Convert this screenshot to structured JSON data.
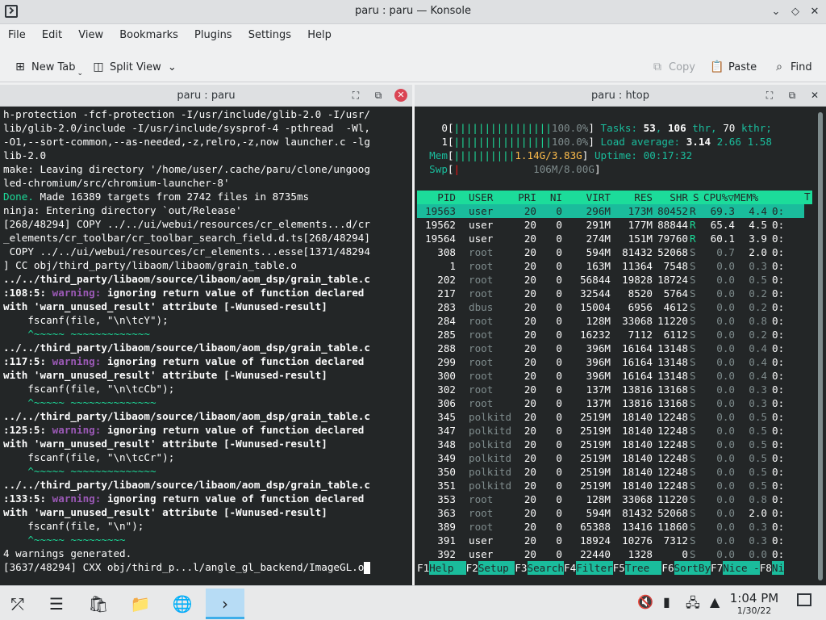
{
  "window": {
    "title": "paru : paru — Konsole"
  },
  "menu": [
    "File",
    "Edit",
    "View",
    "Bookmarks",
    "Plugins",
    "Settings",
    "Help"
  ],
  "toolbar": {
    "new_tab": "New Tab",
    "split_view": "Split View",
    "copy": "Copy",
    "paste": "Paste",
    "find": "Find"
  },
  "left_pane": {
    "title": "paru : paru",
    "lines": [
      {
        "t": "h-protection -fcf-protection -I/usr/include/glib-2.0 -I/usr/",
        "s": ""
      },
      {
        "t": "lib/glib-2.0/include -I/usr/include/sysprof-4 -pthread  -Wl,",
        "s": ""
      },
      {
        "t": "-O1,--sort-common,--as-needed,-z,relro,-z,now launcher.c -lg",
        "s": ""
      },
      {
        "t": "lib-2.0",
        "s": ""
      },
      {
        "t": "make: Leaving directory '/home/user/.cache/paru/clone/ungoog",
        "s": ""
      },
      {
        "t": "led-chromium/src/chromium-launcher-8'",
        "s": ""
      },
      {
        "t": "",
        "s": "done"
      },
      {
        "t": "ninja: Entering directory `out/Release'",
        "s": ""
      },
      {
        "t": "[268/48294] COPY ../../ui/webui/resources/cr_elements...d/cr",
        "s": ""
      },
      {
        "t": "_elements/cr_toolbar/cr_toolbar_search_field.d.ts[268/48294]",
        "s": ""
      },
      {
        "t": " COPY ../../ui/webui/resources/cr_elements...esse[1371/48294",
        "s": ""
      },
      {
        "t": "] CC obj/third_party/libaom/libaom/grain_table.o",
        "s": ""
      },
      {
        "t": "../../third_party/libaom/source/libaom/aom_dsp/grain_table.c",
        "s": "bold"
      },
      {
        "t": ":108:5: ",
        "s": "warn",
        "w": "ignoring return value of function declared"
      },
      {
        "t": "with 'warn_unused_result' attribute [-Wunused-result]",
        "s": "bold"
      },
      {
        "t": "    fscanf(file, \"\\n\\tcY\");",
        "s": ""
      },
      {
        "t": "    ^~~~~~ ~~~~~~~~~~~~~",
        "s": "green"
      },
      {
        "t": "../../third_party/libaom/source/libaom/aom_dsp/grain_table.c",
        "s": "bold"
      },
      {
        "t": ":117:5: ",
        "s": "warn",
        "w": "ignoring return value of function declared"
      },
      {
        "t": "with 'warn_unused_result' attribute [-Wunused-result]",
        "s": "bold"
      },
      {
        "t": "    fscanf(file, \"\\n\\tcCb\");",
        "s": ""
      },
      {
        "t": "    ^~~~~~ ~~~~~~~~~~~~~~",
        "s": "green"
      },
      {
        "t": "../../third_party/libaom/source/libaom/aom_dsp/grain_table.c",
        "s": "bold"
      },
      {
        "t": ":125:5: ",
        "s": "warn",
        "w": "ignoring return value of function declared"
      },
      {
        "t": "with 'warn_unused_result' attribute [-Wunused-result]",
        "s": "bold"
      },
      {
        "t": "    fscanf(file, \"\\n\\tcCr\");",
        "s": ""
      },
      {
        "t": "    ^~~~~~ ~~~~~~~~~~~~~~",
        "s": "green"
      },
      {
        "t": "../../third_party/libaom/source/libaom/aom_dsp/grain_table.c",
        "s": "bold"
      },
      {
        "t": ":133:5: ",
        "s": "warn",
        "w": "ignoring return value of function declared"
      },
      {
        "t": "with 'warn_unused_result' attribute [-Wunused-result]",
        "s": "bold"
      },
      {
        "t": "    fscanf(file, \"\\n\");",
        "s": ""
      },
      {
        "t": "    ^~~~~~ ~~~~~~~~~",
        "s": "green"
      },
      {
        "t": "4 warnings generated.",
        "s": ""
      },
      {
        "t": "[3637/48294] CXX obj/third_p...l/angle_gl_backend/ImageGL.o",
        "s": "cursor"
      }
    ],
    "done_word": "Done.",
    "done_rest": " Made 16389 targets from 2742 files in 8735ms",
    "warning_word": "warning:"
  },
  "right_pane": {
    "title": "paru : htop",
    "cpu0": {
      "label": "0",
      "bar": "||||||||||||||||",
      "pct": "100.0%"
    },
    "cpu1": {
      "label": "1",
      "bar": "||||||||||||||||",
      "pct": "100.0%"
    },
    "mem": {
      "label": "Mem",
      "bar": "||||||||||",
      "val": "1.14G/3.83G"
    },
    "swp": {
      "label": "Swp",
      "bar": "|",
      "val": "106M/8.00G"
    },
    "tasks": {
      "label": "Tasks: ",
      "tasks": "53",
      "thr": "106",
      "kthr": "70",
      "thr_label": " thr, ",
      "kthr_label": " kthr;"
    },
    "load": {
      "label": "Load average: ",
      "v1": "3.14",
      "v2": "2.66",
      "v3": "1.58"
    },
    "uptime": {
      "label": "Uptime: ",
      "value": "00:17:32"
    },
    "header": [
      "PID",
      "USER",
      "PRI",
      "NI",
      "VIRT",
      "RES",
      "SHR",
      "S",
      "CPU%▽MEM%",
      "T"
    ],
    "rows": [
      [
        "19563",
        "user",
        "20",
        "0",
        "296M",
        "173M",
        "80452",
        "R",
        "69.3",
        "4.4",
        "0:"
      ],
      [
        "19562",
        "user",
        "20",
        "0",
        "291M",
        "177M",
        "88844",
        "R",
        "65.4",
        "4.5",
        "0:"
      ],
      [
        "19564",
        "user",
        "20",
        "0",
        "274M",
        "151M",
        "79760",
        "R",
        "60.1",
        "3.9",
        "0:"
      ],
      [
        "308",
        "root",
        "20",
        "0",
        "594M",
        "81432",
        "52068",
        "S",
        "0.7",
        "2.0",
        "0:"
      ],
      [
        "1",
        "root",
        "20",
        "0",
        "163M",
        "11364",
        "7548",
        "S",
        "0.0",
        "0.3",
        "0:"
      ],
      [
        "202",
        "root",
        "20",
        "0",
        "56844",
        "19828",
        "18724",
        "S",
        "0.0",
        "0.5",
        "0:"
      ],
      [
        "217",
        "root",
        "20",
        "0",
        "32544",
        "8520",
        "5764",
        "S",
        "0.0",
        "0.2",
        "0:"
      ],
      [
        "283",
        "dbus",
        "20",
        "0",
        "15004",
        "6956",
        "4612",
        "S",
        "0.0",
        "0.2",
        "0:"
      ],
      [
        "284",
        "root",
        "20",
        "0",
        "128M",
        "33068",
        "11220",
        "S",
        "0.0",
        "0.8",
        "0:"
      ],
      [
        "285",
        "root",
        "20",
        "0",
        "16232",
        "7112",
        "6112",
        "S",
        "0.0",
        "0.2",
        "0:"
      ],
      [
        "288",
        "root",
        "20",
        "0",
        "396M",
        "16164",
        "13148",
        "S",
        "0.0",
        "0.4",
        "0:"
      ],
      [
        "299",
        "root",
        "20",
        "0",
        "396M",
        "16164",
        "13148",
        "S",
        "0.0",
        "0.4",
        "0:"
      ],
      [
        "300",
        "root",
        "20",
        "0",
        "396M",
        "16164",
        "13148",
        "S",
        "0.0",
        "0.4",
        "0:"
      ],
      [
        "302",
        "root",
        "20",
        "0",
        "137M",
        "13816",
        "13168",
        "S",
        "0.0",
        "0.3",
        "0:"
      ],
      [
        "306",
        "root",
        "20",
        "0",
        "137M",
        "13816",
        "13168",
        "S",
        "0.0",
        "0.3",
        "0:"
      ],
      [
        "345",
        "polkitd",
        "20",
        "0",
        "2519M",
        "18140",
        "12248",
        "S",
        "0.0",
        "0.5",
        "0:"
      ],
      [
        "347",
        "polkitd",
        "20",
        "0",
        "2519M",
        "18140",
        "12248",
        "S",
        "0.0",
        "0.5",
        "0:"
      ],
      [
        "348",
        "polkitd",
        "20",
        "0",
        "2519M",
        "18140",
        "12248",
        "S",
        "0.0",
        "0.5",
        "0:"
      ],
      [
        "349",
        "polkitd",
        "20",
        "0",
        "2519M",
        "18140",
        "12248",
        "S",
        "0.0",
        "0.5",
        "0:"
      ],
      [
        "350",
        "polkitd",
        "20",
        "0",
        "2519M",
        "18140",
        "12248",
        "S",
        "0.0",
        "0.5",
        "0:"
      ],
      [
        "351",
        "polkitd",
        "20",
        "0",
        "2519M",
        "18140",
        "12248",
        "S",
        "0.0",
        "0.5",
        "0:"
      ],
      [
        "353",
        "root",
        "20",
        "0",
        "128M",
        "33068",
        "11220",
        "S",
        "0.0",
        "0.8",
        "0:"
      ],
      [
        "363",
        "root",
        "20",
        "0",
        "594M",
        "81432",
        "52068",
        "S",
        "0.0",
        "2.0",
        "0:"
      ],
      [
        "389",
        "root",
        "20",
        "0",
        "65388",
        "13416",
        "11860",
        "S",
        "0.0",
        "0.3",
        "0:"
      ],
      [
        "391",
        "user",
        "20",
        "0",
        "18924",
        "10276",
        "7312",
        "S",
        "0.0",
        "0.3",
        "0:"
      ],
      [
        "392",
        "user",
        "20",
        "0",
        "22440",
        "1328",
        "0",
        "S",
        "0.0",
        "0.0",
        "0:"
      ]
    ],
    "fkeys": [
      {
        "k": "F1",
        "l": "Help  "
      },
      {
        "k": "F2",
        "l": "Setup "
      },
      {
        "k": "F3",
        "l": "Search"
      },
      {
        "k": "F4",
        "l": "Filter"
      },
      {
        "k": "F5",
        "l": "Tree  "
      },
      {
        "k": "F6",
        "l": "SortBy"
      },
      {
        "k": "F7",
        "l": "Nice -"
      },
      {
        "k": "F8",
        "l": "Ni"
      }
    ]
  },
  "taskbar": {
    "time": "1:04 PM",
    "date": "1/30/22"
  },
  "colors": {
    "terminal_bg": "#232627",
    "accent": "#1abc9c",
    "warning": "#9b59b6",
    "close": "#da4453"
  }
}
